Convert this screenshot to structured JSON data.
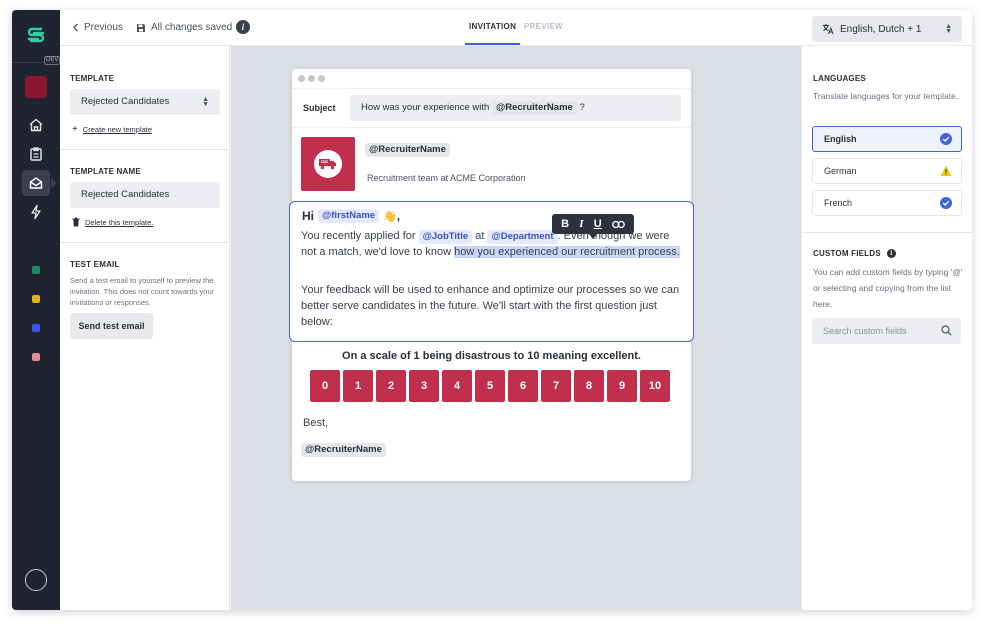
{
  "colors": {
    "accent": "#3d63dd",
    "brand": "#c0304d",
    "rail": "#1f2430",
    "warning": "#f5c518"
  },
  "rail": {
    "badge": "DEV",
    "nav_icons": [
      "home-icon",
      "clipboard-icon",
      "inbox-icon",
      "lightning-icon"
    ],
    "dots": [
      "#1e8a6b",
      "#e3b015",
      "#3d57e8",
      "#e98a95"
    ]
  },
  "topbar": {
    "previous_label": "Previous",
    "saved_label": "All changes saved",
    "info_label": "i",
    "tab_invitation": "INVITATION",
    "tab_preview": "PREVIEW",
    "language_selector": "English, Dutch + 1"
  },
  "left_panel": {
    "template_title": "TEMPLATE",
    "template_value": "Rejected Candidates",
    "create_link": "Create new template",
    "name_title": "TEMPLATE NAME",
    "name_value": "Rejected Candidates",
    "delete_link": "Delete this template.",
    "test_title": "TEST EMAIL",
    "test_help": "Send a test email to yourself to preview the invitation. This does not count towards your invitations or responses.",
    "test_button": "Send test email"
  },
  "email": {
    "subject_label": "Subject",
    "subject_prefix": "How was your experience with",
    "subject_tag": "@RecruiterName",
    "subject_suffix": "?",
    "sender_tag": "@RecruiterName",
    "sender_sub": "Recruitment team at ACME Corporation",
    "greeting": "Hi",
    "greeting_tag": "@firstName",
    "greeting_emoji": "👋",
    "greeting_comma": ",",
    "p1_a": "You recently applied for",
    "p1_tag1": "@JobTitle",
    "p1_at": "at",
    "p1_tag2": "@Department",
    "p1_b": ". Even though we were not a match, we'd love to know",
    "p1_selected": "how you experienced our recruitment process.",
    "p2": "Your feedback will be used to enhance and optimize our processes so we can better serve candidates in the future. We'll start with the first question just below:",
    "scale_title": "On a scale of 1 being disastrous to 10 meaning excellent.",
    "scale": [
      "0",
      "1",
      "2",
      "3",
      "4",
      "5",
      "6",
      "7",
      "8",
      "9",
      "10"
    ],
    "best": "Best,",
    "signature_tag": "@RecruiterName",
    "toolbar": {
      "bold": "B",
      "italic": "I",
      "underline": "U"
    }
  },
  "right_panel": {
    "languages_title": "LANGUAGES",
    "languages_desc": "Translate languages for your template.",
    "languages": [
      {
        "label": "English",
        "status": "check"
      },
      {
        "label": "German",
        "status": "warning"
      },
      {
        "label": "French",
        "status": "check"
      }
    ],
    "custom_title": "CUSTOM FIELDS",
    "custom_desc": "You can add custom fields by typing '@' or selecting and copying from the list here.",
    "search_placeholder": "Search custom fields"
  }
}
